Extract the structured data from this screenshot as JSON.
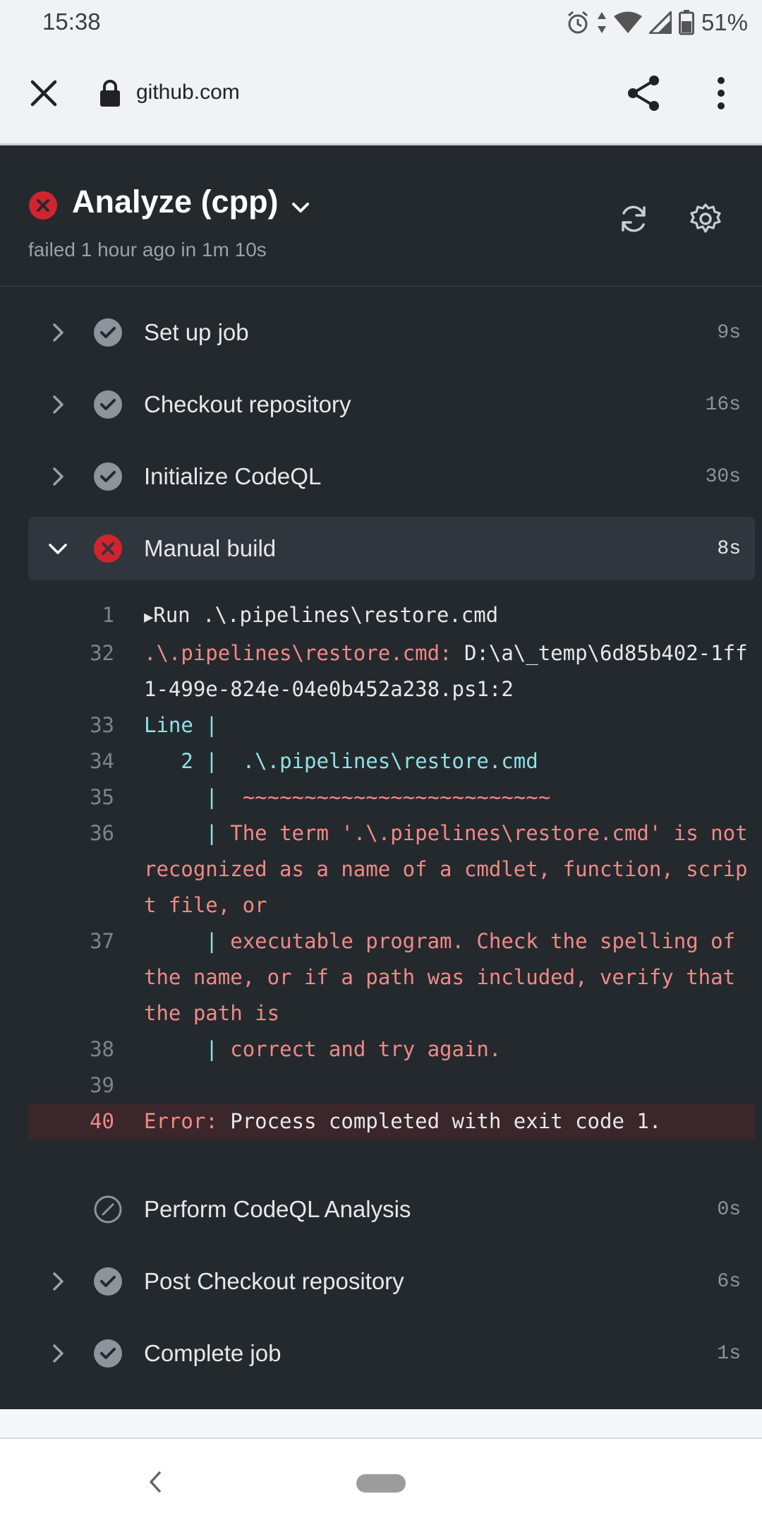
{
  "status_bar": {
    "time": "15:38",
    "battery": "51%",
    "icons": [
      "alarm-icon",
      "data-arrows-icon",
      "wifi-icon",
      "signal-icon",
      "battery-icon"
    ]
  },
  "browser": {
    "url": "github.com",
    "icons": [
      "close-icon",
      "lock-icon",
      "share-icon",
      "more-vert-icon"
    ]
  },
  "job": {
    "title": "Analyze (cpp)",
    "subtitle": "failed 1 hour ago in 1m 10s"
  },
  "steps": [
    {
      "label": "Set up job",
      "duration": "9s",
      "status": "success"
    },
    {
      "label": "Checkout repository",
      "duration": "16s",
      "status": "success"
    },
    {
      "label": "Initialize CodeQL",
      "duration": "30s",
      "status": "success"
    },
    {
      "label": "Manual build",
      "duration": "8s",
      "status": "failure"
    },
    {
      "label": "Perform CodeQL Analysis",
      "duration": "0s",
      "status": "skipped"
    },
    {
      "label": "Post Checkout repository",
      "duration": "6s",
      "status": "success"
    },
    {
      "label": "Complete job",
      "duration": "1s",
      "status": "success"
    }
  ],
  "log": {
    "l1_num": "1",
    "l1_text": "Run .\\.pipelines\\restore.cmd",
    "l32_num": "32",
    "l32_red": ".\\.pipelines\\restore.cmd: ",
    "l32_white": "D:\\a\\_temp\\6d85b402-1ff1-499e-824e-04e0b452a238.ps1:2",
    "l33_num": "33",
    "l33_text": "Line |",
    "l34_num": "34",
    "l34_text": "   2 |  .\\.pipelines\\restore.cmd",
    "l35_num": "35",
    "l35_bar": "     |  ",
    "l35_text": "~~~~~~~~~~~~~~~~~~~~~~~~~",
    "l36_num": "36",
    "l36_bar": "     | ",
    "l36_text": "The term '.\\.pipelines\\restore.cmd' is not recognized as a name of a cmdlet, function, script file, or",
    "l37_num": "37",
    "l37_bar": "     | ",
    "l37_text": "executable program. Check the spelling of the name, or if a path was included, verify that the path is",
    "l38_num": "38",
    "l38_bar": "     | ",
    "l38_text": "correct and try again.",
    "l39_num": "39",
    "l40_num": "40",
    "l40_red": "Error: ",
    "l40_white": "Process completed with exit code 1."
  },
  "colors": {
    "panel_bg": "#24292e",
    "failure": "#d1242f",
    "success_icon": "#8d949b",
    "log_red": "#f08a86",
    "log_cyan": "#8fe1e6"
  }
}
